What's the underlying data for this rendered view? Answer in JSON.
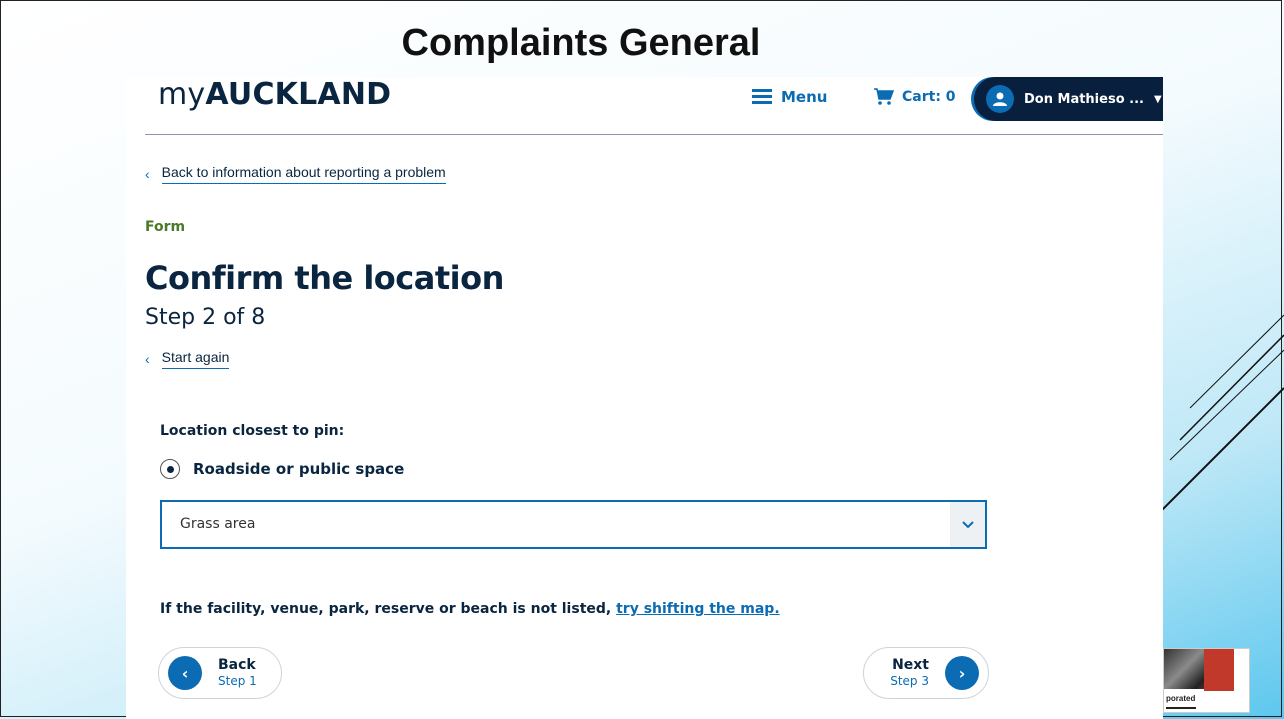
{
  "slide": {
    "title": "Complaints General",
    "thumbnail_caption": "porated"
  },
  "header": {
    "logo_my": "my",
    "logo_city": "AUCKLAND",
    "menu_label": "Menu",
    "cart_label": "Cart: 0",
    "user_name": "Don Mathieso ..."
  },
  "back_link": "Back to information about reporting a problem",
  "form_tag": "Form",
  "page_title": "Confirm the location",
  "step_text": "Step 2 of 8",
  "start_again": "Start again",
  "location": {
    "label": "Location closest to pin:",
    "radio_option": "Roadside or public space",
    "radio_selected": true,
    "select_value": "Grass area"
  },
  "info": {
    "text": "If the facility, venue, park, reserve or beach is not listed, ",
    "link": "try shifting the map."
  },
  "nav": {
    "back_label": "Back",
    "back_step": "Step 1",
    "next_label": "Next",
    "next_step": "Step 3"
  },
  "colors": {
    "accent_blue": "#0b6bb3",
    "navy": "#0a2540",
    "user_bar": "#081f3d",
    "form_green": "#4a7a2a"
  },
  "icons": [
    "hamburger-menu-icon",
    "cart-icon",
    "user-avatar-icon",
    "caret-down-icon",
    "chevron-left-icon",
    "chevron-down-icon",
    "chevron-right-icon",
    "radio-selected-icon"
  ]
}
